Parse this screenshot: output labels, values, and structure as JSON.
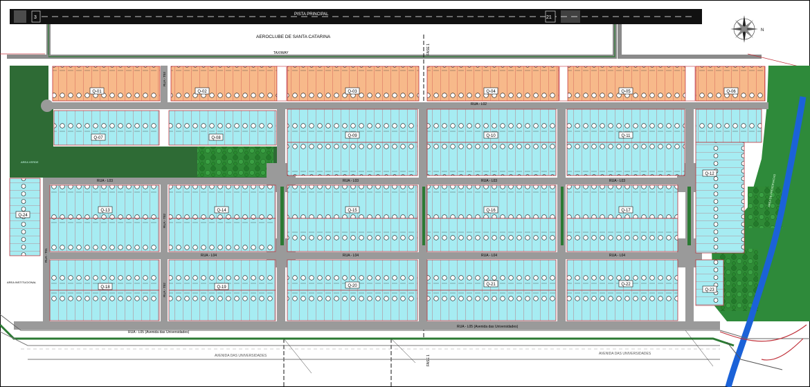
{
  "top": {
    "runway_label": "PISTA PRINCIPAL",
    "runway_number_left": "3",
    "runway_number_right": "21",
    "aeroclub_label": "AEROCLUBE DE SANTA CATARINA",
    "taxiway_label": "TAXIWAY",
    "phase_label": "FASE 1"
  },
  "streets": {
    "l02": "RUA - L02",
    "l03": "RUA - L03",
    "l04": "RUA - L04",
    "l05": "RUA - L05 (Avenida das Universidades)",
    "t01": "RUA - T01",
    "t02": "RUA - T02",
    "t03": "RUA - T03",
    "avenue": "AVENIDA DAS UNIVERSIDADES"
  },
  "green_areas": {
    "left_label": "AREA VERDE",
    "right_label": "AREA DE PRESERVACAO",
    "institutional_label": "AREA INSTITUCIONAL"
  },
  "blocks": [
    {
      "label": "Q-01"
    },
    {
      "label": "Q-02"
    },
    {
      "label": "Q-03"
    },
    {
      "label": "Q-04"
    },
    {
      "label": "Q-05"
    },
    {
      "label": "Q-06"
    },
    {
      "label": "Q-07"
    },
    {
      "label": "Q-08"
    },
    {
      "label": "Q-09"
    },
    {
      "label": "Q-10"
    },
    {
      "label": "Q-11"
    },
    {
      "label": "Q-12"
    },
    {
      "label": "Q-13"
    },
    {
      "label": "Q-14"
    },
    {
      "label": "Q-15"
    },
    {
      "label": "Q-16"
    },
    {
      "label": "Q-17"
    },
    {
      "label": "Q-18"
    },
    {
      "label": "Q-19"
    },
    {
      "label": "Q-20"
    },
    {
      "label": "Q-21"
    },
    {
      "label": "Q-22"
    },
    {
      "label": "Q-23"
    },
    {
      "label": "Q-24"
    }
  ],
  "colors": {
    "lot_blue": "#a6ecf2",
    "lot_orange": "#f7b98a",
    "lot_border": "#c0313a",
    "road": "#9a9a9a",
    "grass": "#2e6b35",
    "river": "#1b62d8"
  }
}
